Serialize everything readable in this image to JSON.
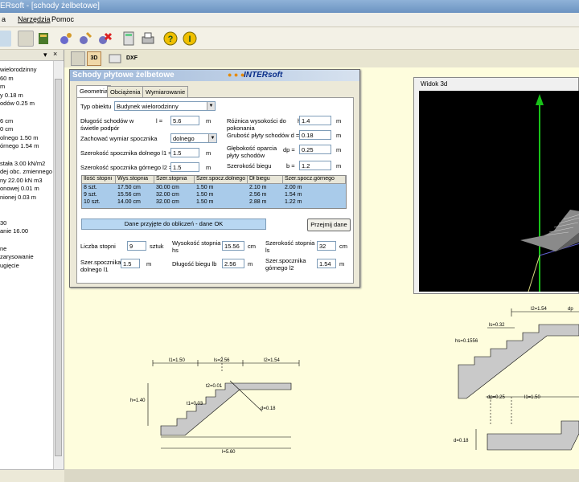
{
  "window": {
    "title": "ERsoft - [schody żelbetowe]"
  },
  "menu": {
    "items": [
      "a",
      "Narzędzia",
      "Pomoc"
    ]
  },
  "left_panel": {
    "lines": [
      "wielorodzinny",
      "60 m",
      "m",
      "y 0.18 m",
      "odów 0.25 m",
      "",
      "6 cm",
      "0 cm",
      "olnego 1.50 m",
      "órnego 1.54 m",
      "",
      "stała 3.00 kN/m2",
      "dej obc. zmiennego 0",
      "ny 22.00 kN m3",
      "onowej 0.01 m",
      "nionej 0.03 m",
      "",
      "",
      "30",
      "anie 16.00",
      "",
      "ne",
      "zarysowanie",
      "ugięcie"
    ]
  },
  "doc_toolbar": {
    "b1": "3D",
    "b2": "DXF"
  },
  "dialog": {
    "title": "Schody płytowe żelbetowe",
    "brand": "INTERsoft",
    "dots": "● ● ●",
    "tabs": [
      "Geometria",
      "Obciążenia",
      "Wymiarowanie"
    ],
    "typ_label": "Typ obiektu",
    "typ_value": "Budynek wielorodzinny",
    "dlugosc_label": "Długość schodów w świetle podpór",
    "dlugosc_sym": "l =",
    "dlugosc_value": "5.6",
    "dlugosc_unit": "m",
    "zachowac_label": "Zachować wymiar spocznika",
    "zachowac_value": "dolnego",
    "szer_dol_label": "Szerokość spocznika dolnego l1 =",
    "szer_dol_value": "1.5",
    "szer_dol_unit": "m",
    "szer_gor_label": "Szerokość spocznika górnego l2 =",
    "szer_gor_value": "1.5",
    "szer_gor_unit": "m",
    "roznica_label": "Różnica wysokości do pokonania",
    "roznica_sym": "h =",
    "roznica_value": "1.4",
    "roznica_unit": "m",
    "grubosc_label": "Grubość płyty schodów d =",
    "grubosc_value": "0.18",
    "grubosc_unit": "m",
    "glebokosc_label": "Głębokość oparcia płyty schodów",
    "glebokosc_sym": "dp =",
    "glebokosc_value": "0.25",
    "glebokosc_unit": "m",
    "szer_biegu_label": "Szerokość biegu",
    "szer_biegu_sym": "b =",
    "szer_biegu_value": "1.2",
    "szer_biegu_unit": "m",
    "grid": {
      "headers": [
        "Ilość stopni",
        "Wys.stopnia",
        "Szer.stopnia",
        "Szer.spocz.dolnego",
        "Dł biegu",
        "Szer.spocz.górnego"
      ],
      "rows": [
        [
          "8 szt.",
          "17.50 cm",
          "30.00 cm",
          "1.50 m",
          "2.10 m",
          "2.00 m"
        ],
        [
          "9 szt.",
          "15.56 cm",
          "32.00 cm",
          "1.50 m",
          "2.56 m",
          "1.54 m"
        ],
        [
          "10 szt.",
          "14.00 cm",
          "32.00 cm",
          "1.50 m",
          "2.88 m",
          "1.22 m"
        ]
      ]
    },
    "status": "Dane przyjęte do obliczeń - dane OK",
    "przejmij": "Przejmij dane",
    "liczba_label": "Liczba stopni",
    "liczba_value": "9",
    "liczba_unit": "sztuk",
    "wys_stopnia_label": "Wysokość stopnia hs",
    "wys_stopnia_value": "15.56",
    "wys_stopnia_unit": "cm",
    "szer_stopnia_label": "Szerokość stopnia ls",
    "szer_stopnia_value": "32",
    "szer_stopnia_unit": "cm",
    "spocz_dol_label": "Szer.spocznika dolnego l1",
    "spocz_dol_value": "1.5",
    "spocz_dol_unit": "m",
    "dl_biegu_label": "Długość biegu lb",
    "dl_biegu_value": "2.56",
    "dl_biegu_unit": "m",
    "spocz_gor_label": "Szer.spocznika górnego l2",
    "spocz_gor_value": "1.54",
    "spocz_gor_unit": "m"
  },
  "view3d": {
    "title": "Widok 3d"
  },
  "drawing1": {
    "l1": "l1=1.50",
    "ls": "ls=2.56",
    "l2": "l2=1.54",
    "h": "h=1.40",
    "t2": "t2=0.01",
    "t1": "t1=0.03",
    "d": "d=0.18",
    "l": "l=5.60"
  },
  "drawing2": {
    "l2": "l2=1.54",
    "dp": "dp",
    "ls": "ls=0.32",
    "hs": "hs=0.1556",
    "dp2": "dp=0.25",
    "l1": "l1=1.50",
    "d": "d=0.18"
  },
  "colors": {
    "drawing_bg": "#fefddd",
    "grid_sel": "#a9cbea",
    "concrete": "#c9c9c9",
    "accent": "#0a2f8a"
  }
}
